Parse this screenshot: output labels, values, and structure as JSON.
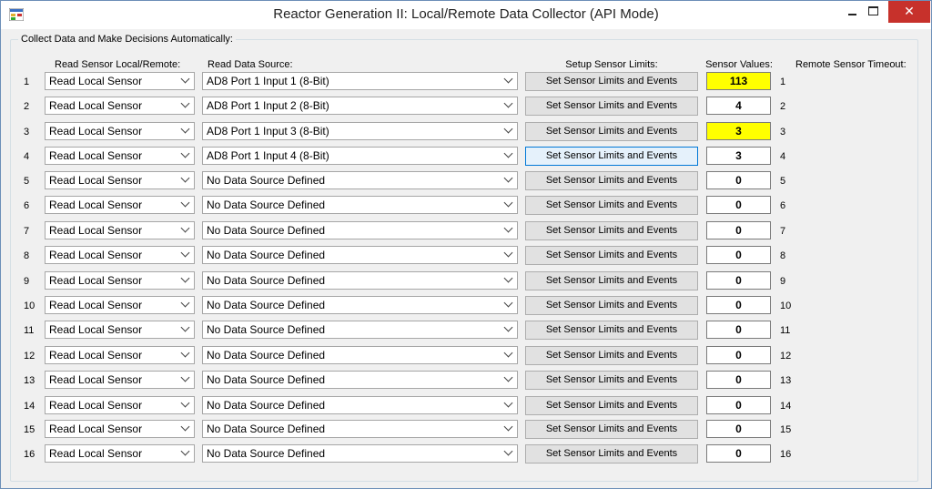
{
  "window": {
    "title": "Reactor Generation II: Local/Remote Data Collector (API Mode)",
    "close_label": "✕"
  },
  "group": {
    "title": "Collect Data and Make Decisions Automatically:"
  },
  "headers": {
    "local_remote": "Read Sensor Local/Remote:",
    "data_source": "Read Data Source:",
    "limits": "Setup Sensor Limits:",
    "values": "Sensor Values:",
    "remote_timeout": "Remote Sensor Timeout:"
  },
  "colors": {
    "highlight": "#ffff00",
    "close": "#c7312b"
  },
  "rows": [
    {
      "num": "1",
      "mode": "Read Local Sensor",
      "source": "AD8 Port 1 Input 1 (8-Bit)",
      "button": "Set Sensor Limits and Events",
      "value": "113",
      "highlight": true,
      "rnum": "1"
    },
    {
      "num": "2",
      "mode": "Read Local Sensor",
      "source": "AD8 Port 1 Input 2 (8-Bit)",
      "button": "Set Sensor Limits and Events",
      "value": "4",
      "highlight": false,
      "rnum": "2"
    },
    {
      "num": "3",
      "mode": "Read Local Sensor",
      "source": "AD8 Port 1 Input 3 (8-Bit)",
      "button": "Set Sensor Limits and Events",
      "value": "3",
      "highlight": true,
      "rnum": "3"
    },
    {
      "num": "4",
      "mode": "Read Local Sensor",
      "source": "AD8 Port 1 Input 4 (8-Bit)",
      "button": "Set Sensor Limits and Events",
      "value": "3",
      "highlight": false,
      "rnum": "4",
      "focused": true
    },
    {
      "num": "5",
      "mode": "Read Local Sensor",
      "source": "No Data Source Defined",
      "button": "Set Sensor Limits and Events",
      "value": "0",
      "highlight": false,
      "rnum": "5"
    },
    {
      "num": "6",
      "mode": "Read Local Sensor",
      "source": "No Data Source Defined",
      "button": "Set Sensor Limits and Events",
      "value": "0",
      "highlight": false,
      "rnum": "6"
    },
    {
      "num": "7",
      "mode": "Read Local Sensor",
      "source": "No Data Source Defined",
      "button": "Set Sensor Limits and Events",
      "value": "0",
      "highlight": false,
      "rnum": "7"
    },
    {
      "num": "8",
      "mode": "Read Local Sensor",
      "source": "No Data Source Defined",
      "button": "Set Sensor Limits and Events",
      "value": "0",
      "highlight": false,
      "rnum": "8"
    },
    {
      "num": "9",
      "mode": "Read Local Sensor",
      "source": "No Data Source Defined",
      "button": "Set Sensor Limits and Events",
      "value": "0",
      "highlight": false,
      "rnum": "9"
    },
    {
      "num": "10",
      "mode": "Read Local Sensor",
      "source": "No Data Source Defined",
      "button": "Set Sensor Limits and Events",
      "value": "0",
      "highlight": false,
      "rnum": "10"
    },
    {
      "num": "11",
      "mode": "Read Local Sensor",
      "source": "No Data Source Defined",
      "button": "Set Sensor Limits and Events",
      "value": "0",
      "highlight": false,
      "rnum": "11"
    },
    {
      "num": "12",
      "mode": "Read Local Sensor",
      "source": "No Data Source Defined",
      "button": "Set Sensor Limits and Events",
      "value": "0",
      "highlight": false,
      "rnum": "12"
    },
    {
      "num": "13",
      "mode": "Read Local Sensor",
      "source": "No Data Source Defined",
      "button": "Set Sensor Limits and Events",
      "value": "0",
      "highlight": false,
      "rnum": "13"
    },
    {
      "num": "14",
      "mode": "Read Local Sensor",
      "source": "No Data Source Defined",
      "button": "Set Sensor Limits and Events",
      "value": "0",
      "highlight": false,
      "rnum": "14"
    },
    {
      "num": "15",
      "mode": "Read Local Sensor",
      "source": "No Data Source Defined",
      "button": "Set Sensor Limits and Events",
      "value": "0",
      "highlight": false,
      "rnum": "15"
    },
    {
      "num": "16",
      "mode": "Read Local Sensor",
      "source": "No Data Source Defined",
      "button": "Set Sensor Limits and Events",
      "value": "0",
      "highlight": false,
      "rnum": "16"
    }
  ]
}
